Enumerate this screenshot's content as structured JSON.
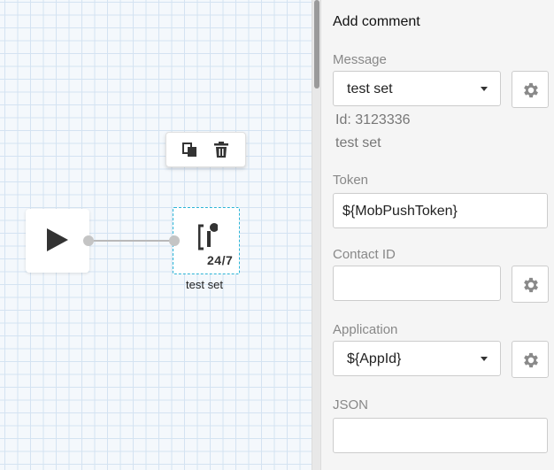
{
  "canvas": {
    "comment_node": {
      "label": "test set",
      "badge": "24/7"
    },
    "toolbar": {
      "copy_icon": "copy-icon",
      "delete_icon": "trash-icon"
    }
  },
  "panel": {
    "title": "Add comment",
    "message": {
      "label": "Message",
      "value": "test set",
      "id_text": "Id: 3123336",
      "name_text": "test set"
    },
    "token": {
      "label": "Token",
      "value": "${MobPushToken}"
    },
    "contact_id": {
      "label": "Contact ID",
      "value": ""
    },
    "application": {
      "label": "Application",
      "value": "${AppId}"
    },
    "json": {
      "label": "JSON",
      "value": ""
    }
  },
  "colors": {
    "accent_dashed": "#2bb4d6",
    "grid_line": "#d4e3f2",
    "icon_gray": "#8a8a8a"
  }
}
